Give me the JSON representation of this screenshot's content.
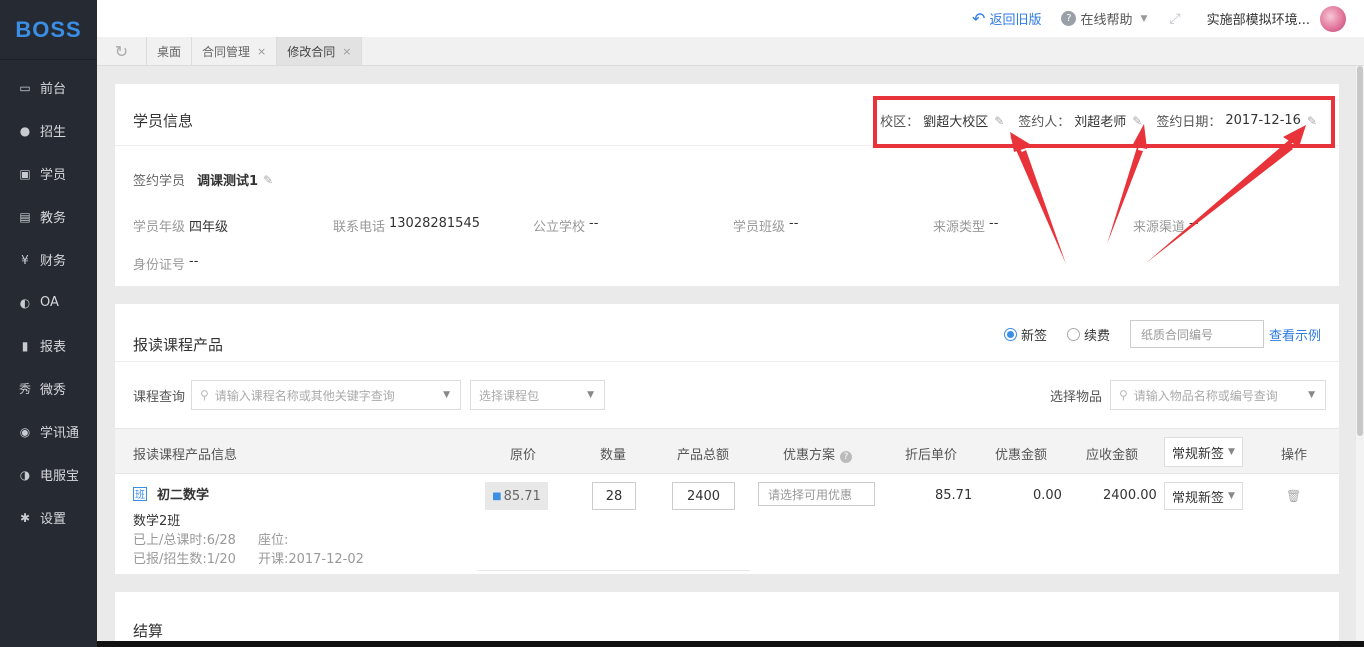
{
  "app": {
    "logo": "BOSS"
  },
  "sidebar": {
    "items": [
      {
        "label": "前台",
        "icon": "calendar-icon"
      },
      {
        "label": "招生",
        "icon": "user-plus-icon"
      },
      {
        "label": "学员",
        "icon": "student-icon"
      },
      {
        "label": "教务",
        "icon": "book-icon"
      },
      {
        "label": "财务",
        "icon": "yen-icon"
      },
      {
        "label": "OA",
        "icon": "chat-icon"
      },
      {
        "label": "报表",
        "icon": "bar-chart-icon"
      },
      {
        "label": "微秀",
        "icon": "weixiu-icon"
      },
      {
        "label": "学讯通",
        "icon": "location-icon"
      },
      {
        "label": "电服宝",
        "icon": "phone-icon"
      },
      {
        "label": "设置",
        "icon": "gear-icon"
      }
    ]
  },
  "topbar": {
    "back_label": "返回旧版",
    "help_label": "在线帮助",
    "user_label": "实施部模拟环境..."
  },
  "tabs": [
    {
      "label": "桌面",
      "closable": false
    },
    {
      "label": "合同管理",
      "closable": true
    },
    {
      "label": "修改合同",
      "closable": true,
      "active": true
    }
  ],
  "student_card": {
    "title": "学员信息",
    "campus_label": "校区：",
    "campus_value": "劉超大校区",
    "signer_label": "签约人：",
    "signer_value": "刘超老师",
    "sign_date_label": "签约日期：",
    "sign_date_value": "2017-12-16",
    "student_label": "签约学员",
    "student_name": "调课测试1",
    "fields": [
      {
        "label": "学员年级",
        "value": "四年级"
      },
      {
        "label": "联系电话",
        "value": "13028281545"
      },
      {
        "label": "公立学校",
        "value": "--"
      },
      {
        "label": "学员班级",
        "value": "--"
      },
      {
        "label": "来源类型",
        "value": "--"
      },
      {
        "label": "来源渠道",
        "value": "--"
      },
      {
        "label": "身份证号",
        "value": "--"
      }
    ]
  },
  "course_card": {
    "title": "报读课程产品",
    "radio_new": "新签",
    "radio_renew": "续费",
    "paper_contract_placeholder": "纸质合同编号",
    "view_example": "查看示例",
    "course_query_label": "课程查询",
    "course_query_placeholder": "请输入课程名称或其他关键字查询",
    "package_placeholder": "选择课程包",
    "goods_label": "选择物品",
    "goods_placeholder": "请输入物品名称或编号查询",
    "columns": {
      "info": "报读课程产品信息",
      "price": "原价",
      "qty": "数量",
      "total": "产品总额",
      "discount": "优惠方案",
      "unit_after": "折后单价",
      "discount_amount": "优惠金额",
      "receivable": "应收金额",
      "type": "常规新签",
      "action": "操作"
    },
    "rows": [
      {
        "badge": "班",
        "name": "初二数学",
        "class_name": "数学2班",
        "progress": "已上/总课时:6/28",
        "seat": "座位:",
        "enrolled": "已报/招生数:1/20",
        "start": "开课:2017-12-02",
        "price": "85.71",
        "qty": "28",
        "total": "2400",
        "discount_placeholder": "请选择可用优惠",
        "unit_after": "85.71",
        "discount_amount": "0.00",
        "receivable": "2400.00",
        "type": "常规新签"
      }
    ]
  },
  "settle_card": {
    "title": "结算"
  },
  "colors": {
    "accent": "#3a8ee6",
    "sidebar": "#262b33",
    "annotation": "#e8333a"
  }
}
